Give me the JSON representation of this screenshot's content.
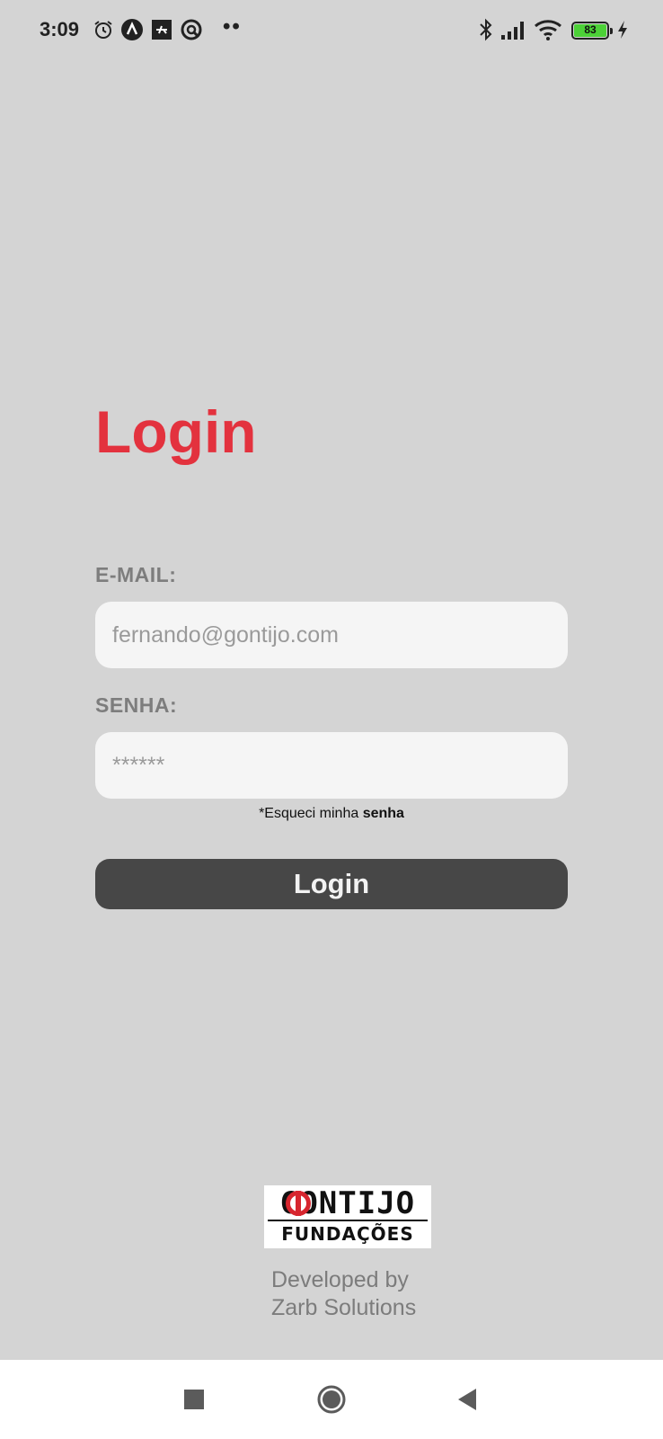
{
  "status_bar": {
    "time": "3:09",
    "battery": "83",
    "icons": [
      "alarm-icon",
      "app-a-icon",
      "app-tile-icon",
      "app-q-icon",
      "more-dots-icon",
      "bluetooth-icon",
      "signal-icon",
      "wifi-icon",
      "battery-icon",
      "charging-icon"
    ],
    "more": "••"
  },
  "login": {
    "title": "Login",
    "email_label": "E-MAIL:",
    "email_placeholder": "fernando@gontijo.com",
    "password_label": "SENHA:",
    "password_placeholder": "******",
    "forgot_prefix": "*Esqueci minha ",
    "forgot_bold": "senha",
    "button_label": "Login"
  },
  "logo": {
    "top_text": "GONTIJO",
    "bottom_text": "FUNDAÇÕES"
  },
  "footer": {
    "line1": "Developed by",
    "line2": "Zarb Solutions"
  },
  "nav": {
    "icons": [
      "recents-icon",
      "home-icon",
      "back-icon"
    ]
  },
  "colors": {
    "background": "#d4d4d4",
    "accent": "#e3323e",
    "button": "#474747",
    "input": "#f5f5f5"
  }
}
